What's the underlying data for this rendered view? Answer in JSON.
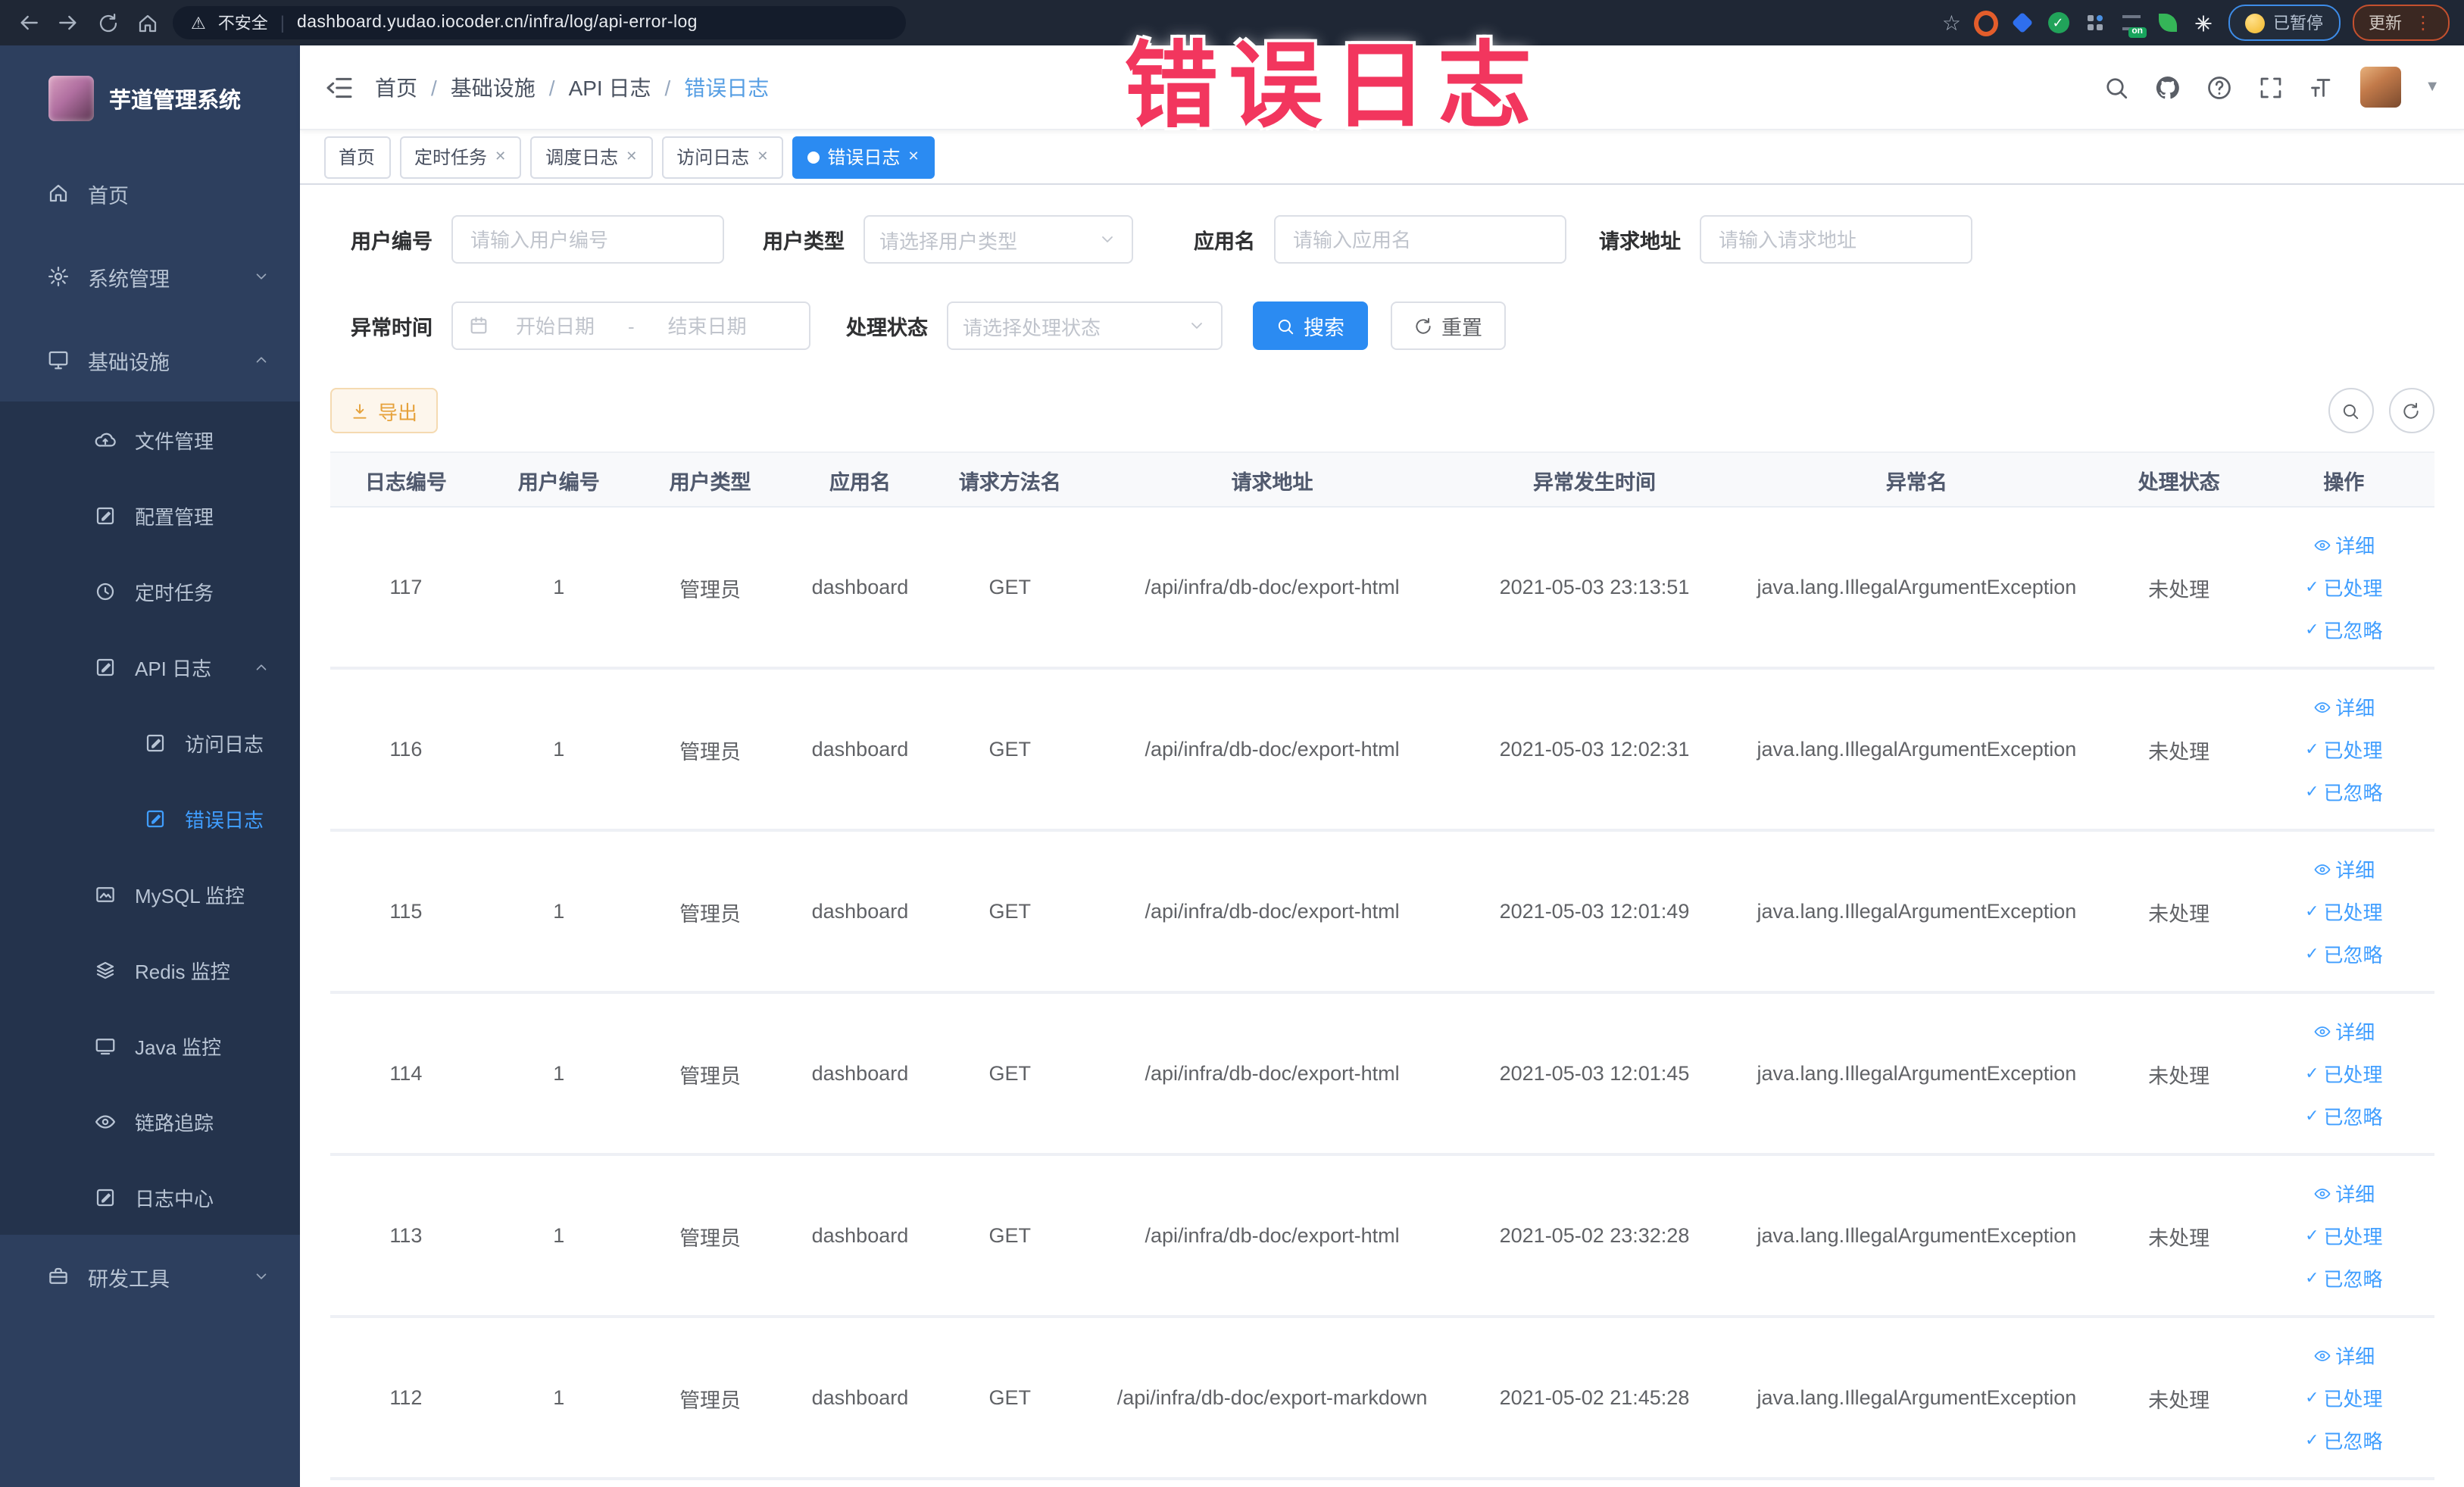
{
  "browser": {
    "security_label": "不安全",
    "url": "dashboard.yudao.iocoder.cn/infra/log/api-error-log",
    "paused_badge": "已暂停",
    "update_label": "更新",
    "on_badge": "on"
  },
  "annotation": {
    "text": "错误日志",
    "color": "#f2365e"
  },
  "icons": {
    "close": "✕",
    "warning": "⚠",
    "divider": "|",
    "slash": "/",
    "dots_vertical": "⋮",
    "check": "✓",
    "star": "☆",
    "caret_down": "▼",
    "question": "?"
  },
  "sidebar": {
    "app_title": "芋道管理系统",
    "items": [
      {
        "label": "首页"
      },
      {
        "label": "系统管理"
      },
      {
        "label": "基础设施"
      },
      {
        "label": "文件管理"
      },
      {
        "label": "配置管理"
      },
      {
        "label": "定时任务"
      },
      {
        "label": "API 日志"
      },
      {
        "label": "访问日志"
      },
      {
        "label": "错误日志"
      },
      {
        "label": "MySQL 监控"
      },
      {
        "label": "Redis 监控"
      },
      {
        "label": "Java 监控"
      },
      {
        "label": "链路追踪"
      },
      {
        "label": "日志中心"
      },
      {
        "label": "研发工具"
      }
    ]
  },
  "header": {
    "breadcrumb": [
      "首页",
      "基础设施",
      "API 日志",
      "错误日志"
    ]
  },
  "tabs": [
    {
      "label": "首页"
    },
    {
      "label": "定时任务"
    },
    {
      "label": "调度日志"
    },
    {
      "label": "访问日志"
    },
    {
      "label": "错误日志"
    }
  ],
  "filters": {
    "user_id": {
      "label": "用户编号",
      "placeholder": "请输入用户编号"
    },
    "user_type": {
      "label": "用户类型",
      "placeholder": "请选择用户类型"
    },
    "app_name": {
      "label": "应用名",
      "placeholder": "请输入应用名"
    },
    "request_url": {
      "label": "请求地址",
      "placeholder": "请输入请求地址"
    },
    "exception_time": {
      "label": "异常时间",
      "start_placeholder": "开始日期",
      "separator": "-",
      "end_placeholder": "结束日期"
    },
    "process_status": {
      "label": "处理状态",
      "placeholder": "请选择处理状态"
    },
    "search_label": "搜索",
    "reset_label": "重置"
  },
  "toolbar": {
    "export_label": "导出"
  },
  "table": {
    "headers": [
      "日志编号",
      "用户编号",
      "用户类型",
      "应用名",
      "请求方法名",
      "请求地址",
      "异常发生时间",
      "异常名",
      "处理状态",
      "操作"
    ],
    "actions": {
      "detail": "详细",
      "processed": "已处理",
      "ignored": "已忽略"
    },
    "rows": [
      {
        "id": "117",
        "user_id": "1",
        "user_type": "管理员",
        "app": "dashboard",
        "method": "GET",
        "url": "/api/infra/db-doc/export-html",
        "time": "2021-05-03 23:13:51",
        "exception": "java.lang.IllegalArgumentException",
        "status": "未处理"
      },
      {
        "id": "116",
        "user_id": "1",
        "user_type": "管理员",
        "app": "dashboard",
        "method": "GET",
        "url": "/api/infra/db-doc/export-html",
        "time": "2021-05-03 12:02:31",
        "exception": "java.lang.IllegalArgumentException",
        "status": "未处理"
      },
      {
        "id": "115",
        "user_id": "1",
        "user_type": "管理员",
        "app": "dashboard",
        "method": "GET",
        "url": "/api/infra/db-doc/export-html",
        "time": "2021-05-03 12:01:49",
        "exception": "java.lang.IllegalArgumentException",
        "status": "未处理"
      },
      {
        "id": "114",
        "user_id": "1",
        "user_type": "管理员",
        "app": "dashboard",
        "method": "GET",
        "url": "/api/infra/db-doc/export-html",
        "time": "2021-05-03 12:01:45",
        "exception": "java.lang.IllegalArgumentException",
        "status": "未处理"
      },
      {
        "id": "113",
        "user_id": "1",
        "user_type": "管理员",
        "app": "dashboard",
        "method": "GET",
        "url": "/api/infra/db-doc/export-html",
        "time": "2021-05-02 23:32:28",
        "exception": "java.lang.IllegalArgumentException",
        "status": "未处理"
      },
      {
        "id": "112",
        "user_id": "1",
        "user_type": "管理员",
        "app": "dashboard",
        "method": "GET",
        "url": "/api/infra/db-doc/export-markdown",
        "time": "2021-05-02 21:45:28",
        "exception": "java.lang.IllegalArgumentException",
        "status": "未处理"
      }
    ]
  },
  "colors": {
    "primary": "#409eff",
    "active_tab": "#2b8bf2",
    "warning": "#e6a23c",
    "sidebar_bg": "#2d3f5e",
    "submenu_bg": "#24334c"
  }
}
